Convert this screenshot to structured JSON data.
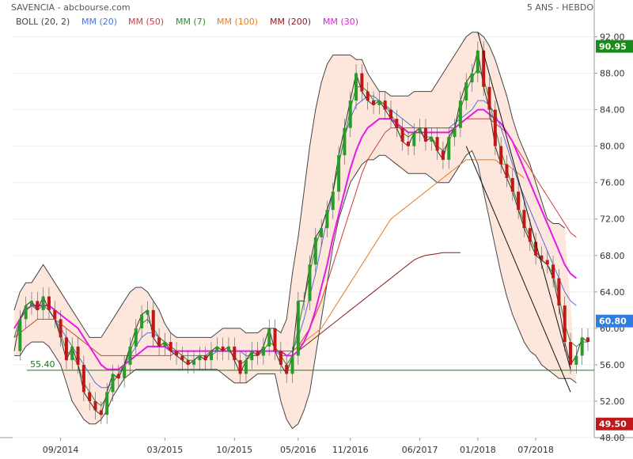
{
  "header": {
    "title": "SAVENCIA - abcbourse.com",
    "period": "5 ANS - HEBDO"
  },
  "legend": [
    {
      "label": "BOLL (20, 2)",
      "color": "#444444"
    },
    {
      "label": "MM (20)",
      "color": "#4a72d9"
    },
    {
      "label": "MM (50)",
      "color": "#d23c3c"
    },
    {
      "label": "MM (7)",
      "color": "#2e8b2e"
    },
    {
      "label": "MM (100)",
      "color": "#e87b1e"
    },
    {
      "label": "MM (200)",
      "color": "#8b1a1a"
    },
    {
      "label": "MM (30)",
      "color": "#e619e6"
    }
  ],
  "chart_data": {
    "type": "line",
    "title": "SAVENCIA - abcbourse.com",
    "ylim": [
      48,
      93
    ],
    "y_ticks": [
      "92.00",
      "88.00",
      "84.00",
      "80.00",
      "76.00",
      "72.00",
      "68.00",
      "64.00",
      "60.00",
      "56.00",
      "52.00",
      "48.00"
    ],
    "x_ticks": [
      "09/2014",
      "03/2015",
      "10/2015",
      "05/2016",
      "11/2016",
      "06/2017",
      "01/2018",
      "07/2018"
    ],
    "badges": [
      {
        "label": "90.95",
        "value": 90.95,
        "color": "#1a8a1a"
      },
      {
        "label": "60.80",
        "value": 60.8,
        "color": "#2e7de0"
      },
      {
        "label": "49.50",
        "value": 49.5,
        "color": "#c01818"
      }
    ],
    "support_level": {
      "label": "55.40",
      "value": 55.4,
      "color": "#1a7a1a"
    },
    "series": [
      {
        "key": "price",
        "color": "#333333",
        "values": [
          57.5,
          61,
          62.5,
          63,
          62,
          63.5,
          62,
          61,
          59,
          56.5,
          58,
          56,
          53,
          52,
          51,
          50.5,
          53,
          55,
          54.5,
          56,
          58,
          60,
          61.5,
          62,
          59,
          58,
          58.5,
          57.5,
          57,
          56.5,
          56,
          56.5,
          57,
          56.5,
          57.5,
          58,
          57.5,
          58,
          56.5,
          55,
          56.5,
          57.5,
          57,
          58,
          60,
          57.5,
          56,
          55,
          57,
          63,
          63,
          67,
          70,
          71,
          73,
          75,
          79,
          82,
          85,
          88,
          86,
          85,
          84.5,
          85,
          84,
          83,
          82,
          80.5,
          80,
          81.5,
          82,
          80.5,
          81,
          79.5,
          78.5,
          81,
          82,
          85,
          87,
          88,
          90.5,
          86.5,
          84,
          80,
          78,
          76.5,
          75,
          73,
          71,
          69.5,
          68,
          67.5,
          67,
          65.5,
          62.5,
          58.5,
          56,
          57,
          59,
          58.5
        ]
      },
      {
        "key": "bb_upper",
        "color": "#444444",
        "values": [
          62,
          64,
          65,
          65,
          66,
          67,
          66,
          65,
          64,
          63,
          62,
          61,
          60,
          59,
          59,
          59,
          60,
          61,
          62,
          63,
          64,
          64.5,
          64.5,
          64,
          63,
          62,
          60.5,
          59.5,
          59,
          59,
          59,
          59,
          59,
          59,
          59,
          59.5,
          60,
          60,
          60,
          60,
          59.5,
          59.5,
          59.5,
          60,
          60,
          60,
          59.5,
          61,
          66,
          70,
          75,
          80,
          84,
          87,
          89,
          90,
          90,
          90,
          90,
          89.5,
          89.5,
          88,
          87,
          86,
          86,
          85.5,
          85.5,
          85.5,
          85.5,
          86,
          86,
          86,
          86,
          87,
          88,
          89,
          90,
          91,
          92,
          92.5,
          92.5,
          92,
          91,
          89.5,
          87.5,
          85.5,
          83,
          81,
          79.5,
          78,
          76,
          74,
          72,
          71.5,
          71.5,
          71
        ]
      },
      {
        "key": "bb_lower",
        "color": "#444444",
        "values": [
          57,
          57,
          58,
          58.5,
          58.5,
          58.5,
          58,
          57,
          56,
          54,
          52,
          51,
          50,
          49.5,
          49.5,
          50,
          51,
          52.5,
          53.5,
          54.5,
          55,
          55.5,
          55.5,
          55.5,
          55.5,
          55.5,
          55.5,
          55.5,
          55.5,
          55.5,
          55.5,
          55.5,
          55.5,
          55.5,
          55.5,
          55.5,
          55,
          54.5,
          54,
          54,
          54,
          54.5,
          55,
          55,
          55,
          55,
          52,
          50,
          49,
          49.5,
          51,
          53,
          57,
          61,
          65,
          69,
          72,
          74,
          76,
          77,
          78,
          78.5,
          78.5,
          79,
          79,
          78.5,
          78,
          77.5,
          77,
          77,
          77,
          77,
          76.5,
          76,
          76,
          76,
          77,
          78,
          79,
          79.5,
          78,
          75,
          72,
          69,
          66,
          63.5,
          61.5,
          60,
          58.5,
          57.5,
          57,
          56,
          55.5,
          55,
          54.5,
          54.5,
          54.5,
          54
        ]
      },
      {
        "key": "mm20",
        "color": "#4a72d9",
        "values": [
          59,
          61,
          62,
          62.5,
          62.5,
          62.5,
          62,
          61,
          60,
          59,
          58,
          57,
          56,
          55,
          54,
          53.5,
          53.5,
          54,
          55,
          56,
          57,
          58,
          59,
          59.5,
          59.5,
          59,
          58.5,
          58,
          57.5,
          57,
          57,
          57,
          57,
          57,
          57,
          57.5,
          57.5,
          57.5,
          57.5,
          57.5,
          57,
          57,
          57,
          57.5,
          57.5,
          57.5,
          57,
          57,
          57.5,
          59,
          61,
          63.5,
          66,
          69,
          72,
          75,
          78,
          81,
          83,
          84.5,
          85,
          85.5,
          85.5,
          85,
          84.5,
          84,
          83.5,
          83,
          82.5,
          82,
          82,
          82,
          82,
          82,
          82,
          82,
          82.5,
          83,
          83.5,
          84,
          85,
          85,
          84.5,
          83.5,
          82,
          80,
          78,
          76,
          74.5,
          73,
          71.5,
          70,
          68.5,
          67,
          65.5,
          64,
          63,
          62.5
        ]
      },
      {
        "key": "mm50",
        "color": "#d23c3c",
        "values": [
          59,
          59.5,
          60,
          60.5,
          61,
          61,
          61,
          61,
          60.5,
          60,
          59.5,
          59,
          58.5,
          58,
          57.5,
          57,
          57,
          57,
          57,
          57,
          57,
          57,
          57,
          57,
          57,
          57,
          57,
          57,
          57.5,
          57.5,
          57.5,
          57.5,
          57.5,
          57.5,
          57.5,
          57.5,
          57.5,
          57.5,
          57.5,
          57.5,
          57.5,
          57.5,
          57.5,
          57.5,
          57.5,
          57.5,
          57.5,
          57.5,
          57.5,
          58,
          59,
          60,
          61.5,
          63,
          65,
          67,
          69,
          71,
          73,
          75,
          77,
          78.5,
          79.5,
          80.5,
          81.5,
          82,
          82,
          82,
          82,
          82,
          82,
          82,
          82,
          82,
          82,
          82,
          82,
          82.5,
          83,
          83,
          83,
          83,
          83,
          82.5,
          82,
          81.5,
          80.5,
          79.5,
          78.5,
          77.5,
          76.5,
          75.5,
          74.5,
          73.5,
          72.5,
          71.5,
          70.5,
          70
        ]
      },
      {
        "key": "mm7",
        "color": "#2e8b2e",
        "values": [
          59,
          61,
          62,
          62.5,
          62,
          62.5,
          62,
          61,
          59.5,
          57.5,
          57,
          56,
          54,
          53,
          52,
          51.5,
          52.5,
          54,
          55,
          56,
          57.5,
          59,
          60.5,
          61,
          60,
          59,
          58.5,
          58,
          57.5,
          57,
          56.5,
          56.5,
          57,
          57,
          57.5,
          57.5,
          57.5,
          57.5,
          57,
          56,
          56.5,
          57,
          57,
          57.5,
          58.5,
          58,
          57,
          56,
          57,
          60,
          63,
          66,
          69,
          71,
          73,
          75,
          78,
          81,
          84,
          86.5,
          86.5,
          86,
          85,
          85,
          84.5,
          83.5,
          82.5,
          81.5,
          81,
          81.5,
          81.5,
          81,
          81,
          80,
          79.5,
          80.5,
          82,
          84,
          86,
          87.5,
          88.5,
          87.5,
          85,
          82,
          79.5,
          77.5,
          75.5,
          73.5,
          71.5,
          70,
          68.5,
          67.5,
          67,
          66,
          63.5,
          60.5,
          58.5,
          58,
          58.5,
          58.5
        ]
      },
      {
        "key": "mm100",
        "color": "#e87b1e",
        "values": [
          null,
          null,
          null,
          null,
          null,
          null,
          null,
          null,
          null,
          null,
          null,
          null,
          null,
          null,
          null,
          null,
          null,
          null,
          null,
          null,
          null,
          null,
          null,
          null,
          null,
          null,
          null,
          null,
          null,
          null,
          null,
          null,
          null,
          null,
          null,
          null,
          null,
          null,
          null,
          null,
          null,
          null,
          null,
          null,
          null,
          null,
          null,
          null,
          57.5,
          58,
          58.5,
          59,
          59.5,
          60,
          61,
          62,
          63,
          64,
          65,
          66,
          67,
          68,
          69,
          70,
          71,
          72,
          72.5,
          73,
          73.5,
          74,
          74.5,
          75,
          75.5,
          76,
          76.5,
          77,
          77.5,
          78,
          78.5,
          78.5,
          78.5,
          78.5,
          78.5,
          78.5,
          78,
          78,
          77.5,
          77,
          76.5
        ]
      },
      {
        "key": "mm200",
        "color": "#8b1a1a",
        "values": [
          null,
          null,
          null,
          null,
          null,
          null,
          null,
          null,
          null,
          null,
          null,
          null,
          null,
          null,
          null,
          null,
          null,
          null,
          null,
          null,
          null,
          null,
          null,
          null,
          null,
          null,
          null,
          null,
          null,
          null,
          null,
          null,
          null,
          null,
          null,
          null,
          null,
          null,
          null,
          null,
          null,
          null,
          null,
          null,
          null,
          null,
          null,
          null,
          57,
          57.5,
          58,
          58.5,
          59,
          59.5,
          60,
          60.5,
          61,
          61.5,
          62,
          62.5,
          63,
          63.5,
          64,
          64.5,
          65,
          65.5,
          66,
          66.5,
          67,
          67.5,
          67.8,
          68,
          68.1,
          68.2,
          68.3,
          68.3,
          68.3,
          68.3
        ]
      },
      {
        "key": "mm30",
        "color": "#e619e6",
        "values": [
          60,
          61,
          62,
          62.5,
          62.5,
          62.5,
          62.5,
          62,
          61.5,
          61,
          60.5,
          60,
          59,
          58,
          57,
          56,
          55.5,
          55.5,
          55.5,
          56,
          56.5,
          57,
          57.5,
          58,
          58,
          58,
          58,
          57.5,
          57.5,
          57.5,
          57.5,
          57.5,
          57.5,
          57.5,
          57.5,
          57.5,
          57.5,
          57.5,
          57.5,
          57.5,
          57.5,
          57.5,
          57.5,
          57.5,
          57.5,
          57.5,
          57.5,
          57,
          57,
          57.5,
          58.5,
          60,
          62,
          64.5,
          67,
          70,
          72.5,
          75,
          77.5,
          79.5,
          81,
          82,
          82.5,
          83,
          83,
          83,
          82.5,
          82,
          81.5,
          81.5,
          81.5,
          81.5,
          81.5,
          81.5,
          81.5,
          81.5,
          82,
          82.5,
          83,
          83.5,
          84,
          84,
          83.5,
          83,
          82.5,
          81.5,
          80.5,
          79,
          77.5,
          76,
          74.5,
          73,
          71.5,
          70,
          68.5,
          67,
          66,
          65.5
        ]
      }
    ]
  }
}
